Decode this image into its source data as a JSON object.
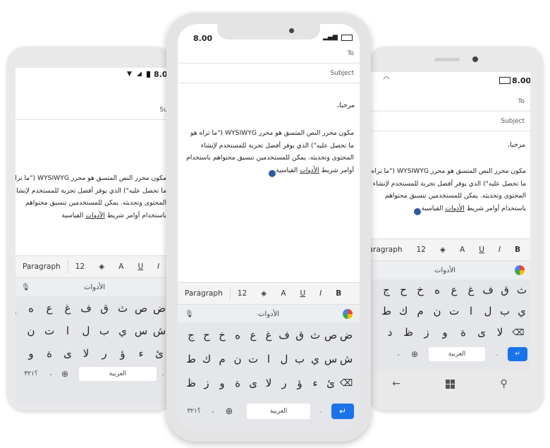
{
  "status": {
    "time": "8.00"
  },
  "email": {
    "to_label": "To",
    "subject_label": "Subject",
    "greeting": "مرحبا،",
    "body": "مكون محرر النص المتسق هو محرر WYSIWYG (\"ما تراه هو ما تحصل عليه\") الذي يوفر أفضل تجربة للمستخدم لإنشاء المحتوى وتحديثه. يمكن للمستخدمين تنسيق محتواهم باستخدام أوامر شريط",
    "link_text": "الأدوات",
    "tail_text": "القياسية"
  },
  "toolbar": {
    "paragraph": "Paragraph",
    "font_size": "12",
    "fill_icon": "paint-bucket-icon",
    "font_color": "A",
    "underline": "U",
    "italic": "I",
    "bold": "B"
  },
  "keyboard": {
    "suggestion": "الأدوات",
    "row1": [
      "ض",
      "ص",
      "ث",
      "ق",
      "ف",
      "غ",
      "ع",
      "ه",
      "خ",
      "ح",
      "ج"
    ],
    "row2": [
      "ش",
      "س",
      "ي",
      "ب",
      "ل",
      "ا",
      "ت",
      "ن",
      "م",
      "ك",
      "ط"
    ],
    "row3": [
      "ئ",
      "ء",
      "ؤ",
      "ر",
      "ﻻ",
      "ى",
      "ة",
      "و",
      "ز",
      "ظ",
      "د"
    ],
    "numbers_label": "؟٣٢١",
    "space_label": "العربية",
    "comma": "،",
    "period": "."
  },
  "colors": {
    "accent": "#1a73e8",
    "caret": "#2f5a9e"
  }
}
